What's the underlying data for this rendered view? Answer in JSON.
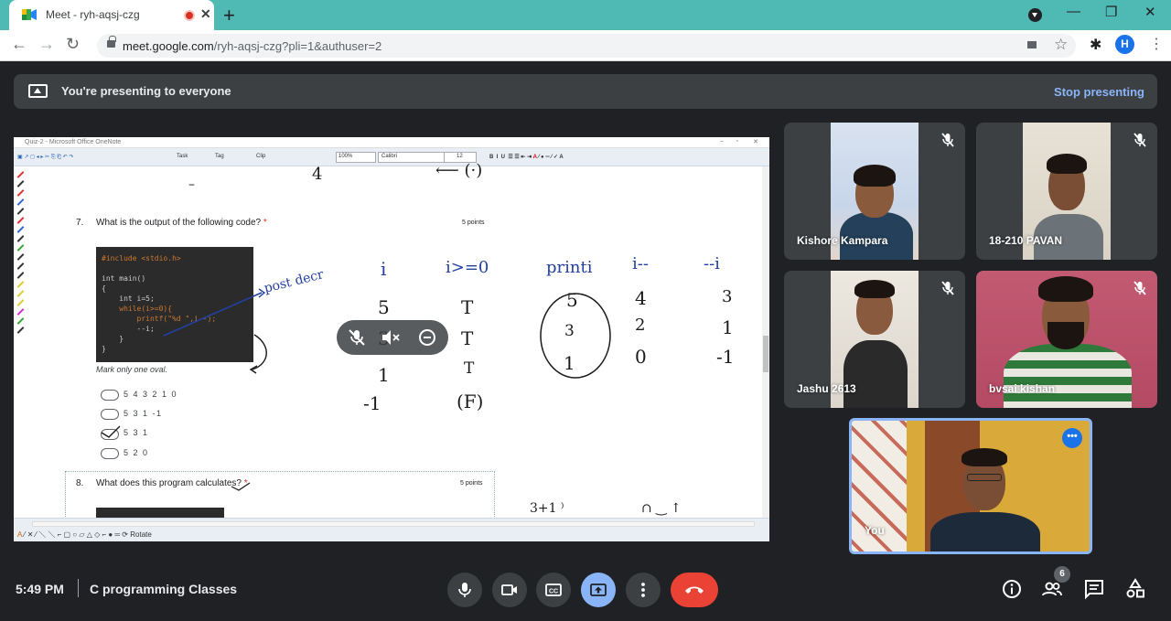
{
  "browser": {
    "tab_title": "Meet - ryh-aqsj-czg",
    "new_tab_label": "+",
    "url_host": "meet.google.com",
    "url_path": "/ryh-aqsj-czg?pli=1&authuser=2",
    "profile_initial": "H",
    "window_controls": {
      "minimize": "—",
      "restore": "❐",
      "close": "✕"
    }
  },
  "banner": {
    "text": "You're presenting to everyone",
    "stop_label": "Stop presenting"
  },
  "onenote": {
    "window_title": "Quiz-2 - Microsoft Office OneNote",
    "font_name": "Calibri",
    "font_size": "12",
    "zoom": "100%",
    "task_label": "Task",
    "tag_label": "Tag",
    "clip_label": "Clip",
    "rotate_label": "Rotate"
  },
  "quiz": {
    "q7": {
      "number": "7.",
      "text": "What is the output of the following code?",
      "required": "*",
      "points": "5 points",
      "code": [
        "#include <stdio.h>",
        "int main()",
        "{",
        "    int i=5;",
        "    while(i>=0){",
        "        printf(\"%d \",i--);",
        "        --i;",
        "    }",
        "}"
      ],
      "mark_text": "Mark only one oval.",
      "options": [
        "5 4 3 2 1 0",
        "5 3 1 -1",
        "5 3 1",
        "5 2 0"
      ]
    },
    "q8": {
      "number": "8.",
      "text": "What does this program calculates?",
      "required": "*",
      "points": "5 points"
    }
  },
  "handwriting": {
    "top_four": "4",
    "post_decr": "post decr",
    "col_i": "i",
    "col_cond": "i>=0",
    "col_printi": "printi",
    "col_idec": "i--",
    "col_predec": "--i",
    "i_values": [
      "5",
      "3",
      "1",
      "-1"
    ],
    "cond_values": [
      "T",
      "T",
      "T",
      "(F)"
    ],
    "print_values": [
      "5",
      "3",
      "1"
    ],
    "idec_values": [
      "4",
      "2",
      "0"
    ],
    "predec_values": [
      "3",
      "1",
      "-1"
    ]
  },
  "participants": [
    {
      "name": "Kishore Kampara",
      "muted": true
    },
    {
      "name": "18-210 PAVAN",
      "muted": true
    },
    {
      "name": "Jashu 2613",
      "muted": true
    },
    {
      "name": "bvsai kishan",
      "muted": true
    }
  ],
  "self_view": {
    "name": "You",
    "more_label": "•••"
  },
  "controls": {
    "time": "5:49 PM",
    "separator": "|",
    "meeting_title": "C programming Classes",
    "people_count": "6"
  },
  "colors": {
    "tab_strip": "#4fb9b3",
    "meet_bg": "#202124",
    "end_call": "#ea4335",
    "present_active": "#8ab4f8",
    "handwriting_blue": "#2340a0"
  }
}
